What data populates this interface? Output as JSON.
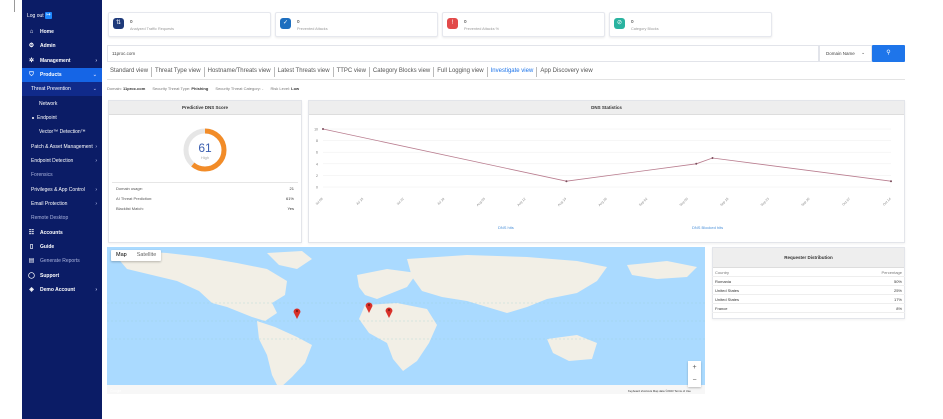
{
  "sidebar": {
    "logout": "Log out",
    "items": [
      {
        "label": "Home",
        "icon": "home-icon"
      },
      {
        "label": "Admin",
        "icon": "admin-icon"
      },
      {
        "label": "Management",
        "icon": "gear-icon"
      },
      {
        "label": "Products",
        "icon": "shield-icon"
      },
      {
        "label": "Threat Prevention"
      },
      {
        "label": "Network"
      },
      {
        "label": "Endpoint"
      },
      {
        "label": "Vector™ Detection™"
      },
      {
        "label": "Patch & Asset Management"
      },
      {
        "label": "Endpoint Detection"
      },
      {
        "label": "Forensics"
      },
      {
        "label": "Privileges & App Control"
      },
      {
        "label": "Email Protection"
      },
      {
        "label": "Remote Desktop"
      },
      {
        "label": "Accounts",
        "icon": "accounts-icon"
      },
      {
        "label": "Guide",
        "icon": "guide-icon"
      },
      {
        "label": "Generate Reports",
        "icon": "reports-icon"
      },
      {
        "label": "Support",
        "icon": "support-icon"
      },
      {
        "label": "Demo Account",
        "icon": "demo-icon"
      }
    ]
  },
  "stats": [
    {
      "value": "0",
      "label": "Analyzed Traffic Requests",
      "color": "#1f3a7a"
    },
    {
      "value": "0",
      "label": "Prevented Attacks",
      "color": "#1e6fbf"
    },
    {
      "value": "0",
      "label": "Prevented Attacks %",
      "color": "#e24a4a"
    },
    {
      "value": "0",
      "label": "Category Blocks",
      "color": "#2ab3a0"
    }
  ],
  "search": {
    "value": "11proc.com",
    "type": "Domain Name",
    "button_icon": "search-icon"
  },
  "tabs": [
    "Standard view",
    "Threat Type view",
    "Hostname/Threats view",
    "Latest Threats view",
    "TTPC view",
    "Category Blocks view",
    "Full Logging view",
    "Investigate view",
    "App Discovery view"
  ],
  "selected_tab": "Investigate view",
  "filters": {
    "domain_label": "Domain:",
    "domain": "11proc.com",
    "threat_type_label": "Security Threat Type:",
    "threat_type": "Phishing",
    "threat_category_label": "Security Threat Category: -",
    "risk_label": "Risk Level:",
    "risk": "Low"
  },
  "dns_score": {
    "title": "Predictive DNS Score",
    "score": "61",
    "level": "High",
    "ring_fraction": 0.61,
    "rows": [
      {
        "label": "Domain usage:",
        "value": "21"
      },
      {
        "label": "AI Threat Prediction:",
        "value": "61%"
      },
      {
        "label": "Blacklist Match:",
        "value": "Yes"
      }
    ]
  },
  "dns_stats": {
    "title": "DNS Statistics",
    "legend_hits": "DNS hits",
    "legend_blocked": "DNS Blocked hits"
  },
  "chart_data": {
    "type": "line",
    "title": "DNS Statistics",
    "ylim": [
      0,
      10
    ],
    "yticks": [
      0,
      2,
      4,
      6,
      8,
      10
    ],
    "x": [
      "Jul 08",
      "Jul 15",
      "Jul 22",
      "Jul 29",
      "Aug 05",
      "Aug 12",
      "Aug 19",
      "Aug 26",
      "Sep 02",
      "Sep 09",
      "Sep 16",
      "Sep 23",
      "Sep 30",
      "Oct 07",
      "Oct 14"
    ],
    "series": [
      {
        "name": "DNS hits",
        "color": "#b97d8f",
        "points": [
          [
            0,
            10
          ],
          [
            6,
            1
          ],
          [
            9.2,
            4
          ],
          [
            9.6,
            5
          ],
          [
            14,
            1
          ]
        ]
      }
    ]
  },
  "map": {
    "tab_map": "Map",
    "tab_satellite": "Satellite",
    "footer": "Keyboard shortcuts   Map data ©2023   Terms of Use",
    "logo": "Google"
  },
  "requester": {
    "title": "Requester Distribution",
    "col_country": "Country",
    "col_percentage": "Percentage",
    "rows": [
      {
        "country": "Romania",
        "pct": "50%"
      },
      {
        "country": "United States",
        "pct": "25%"
      },
      {
        "country": "United States",
        "pct": "17%"
      },
      {
        "country": "France",
        "pct": "8%"
      }
    ]
  }
}
